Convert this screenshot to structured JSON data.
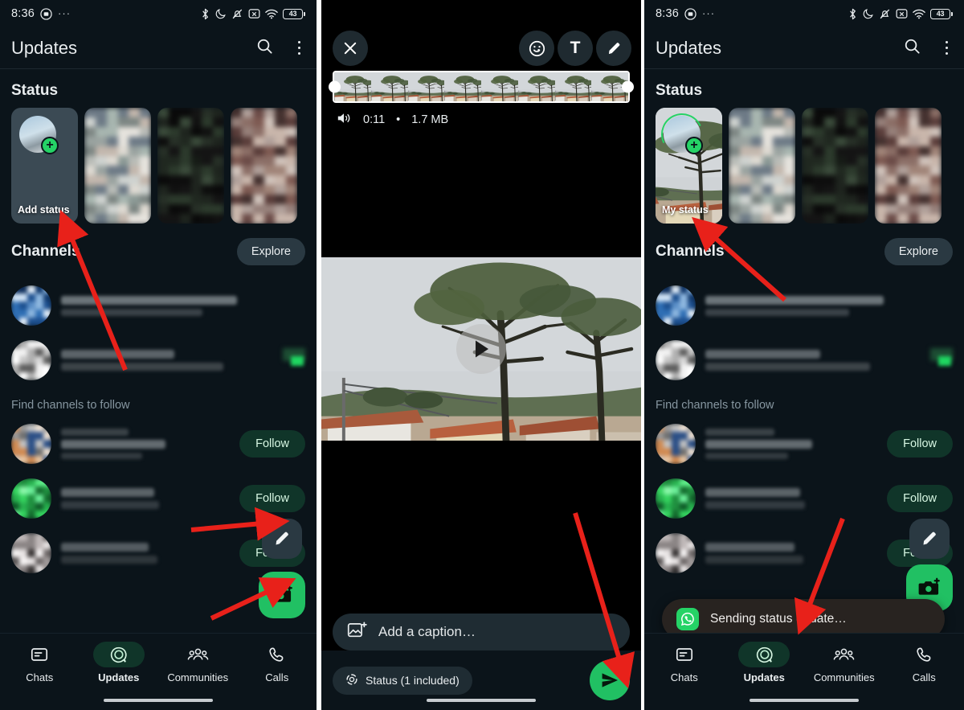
{
  "accent": {
    "green": "#21c063",
    "green_bright": "#25d366",
    "dark_green": "#103529",
    "bg": "#0b141a",
    "surface": "#2a3942",
    "arrow_red": "#e8211a",
    "text": "#e9edef",
    "muted": "#8696a0"
  },
  "status_bar": {
    "time": "8:36",
    "dots": "···",
    "icons": [
      "record-icon",
      "bluetooth-icon",
      "do-not-disturb-icon",
      "bell-muted-icon",
      "screenshot-icon",
      "wifi-icon"
    ],
    "battery_level": "43"
  },
  "panel1": {
    "app_bar": {
      "title": "Updates",
      "search_icon": "search-icon",
      "menu_icon": "overflow-menu-icon"
    },
    "status_section": {
      "title": "Status",
      "add_status_label": "Add status",
      "tiles": [
        "add-status-tile",
        "status-preview-1",
        "status-preview-2",
        "status-preview-3"
      ]
    },
    "channels_section": {
      "title": "Channels",
      "explore_label": "Explore",
      "find_label": "Find channels to follow",
      "follow_label": "Follow"
    },
    "fabs": {
      "pencil": "pencil-fab",
      "camera": "camera-fab"
    },
    "bottom_nav": [
      {
        "label": "Chats",
        "icon": "chats-icon",
        "active": false
      },
      {
        "label": "Updates",
        "icon": "updates-icon",
        "active": true
      },
      {
        "label": "Communities",
        "icon": "communities-icon",
        "active": false
      },
      {
        "label": "Calls",
        "icon": "calls-icon",
        "active": false
      }
    ]
  },
  "panel2": {
    "toolbar": {
      "close_icon": "close-icon",
      "sticker_icon": "sticker-icon",
      "text_label": "T",
      "draw_icon": "pencil-draw-icon"
    },
    "media": {
      "duration": "0:11",
      "separator": "•",
      "file_size": "1.7 MB",
      "audio_icon": "speaker-icon",
      "play_icon": "play-icon"
    },
    "caption": {
      "placeholder": "Add a caption…",
      "icon": "image-add-icon"
    },
    "send_row": {
      "status_chip": "Status (1 included)",
      "chip_icon": "status-ring-icon",
      "send_icon": "send-icon"
    }
  },
  "panel3": {
    "app_bar": {
      "title": "Updates",
      "search_icon": "search-icon",
      "menu_icon": "overflow-menu-icon"
    },
    "status_section": {
      "title": "Status",
      "my_status_label": "My status",
      "tiles": [
        "my-status-tile",
        "status-preview-1",
        "status-preview-2",
        "status-preview-3"
      ]
    },
    "channels_section": {
      "title": "Channels",
      "explore_label": "Explore",
      "find_label": "Find channels to follow",
      "follow_label": "Follow"
    },
    "toast": {
      "text": "Sending status update…",
      "icon": "whatsapp-logo-icon"
    },
    "fabs": {
      "pencil": "pencil-fab",
      "camera": "camera-fab"
    },
    "bottom_nav": [
      {
        "label": "Chats",
        "icon": "chats-icon",
        "active": false
      },
      {
        "label": "Updates",
        "icon": "updates-icon",
        "active": true
      },
      {
        "label": "Communities",
        "icon": "communities-icon",
        "active": false
      },
      {
        "label": "Calls",
        "icon": "calls-icon",
        "active": false
      }
    ]
  }
}
